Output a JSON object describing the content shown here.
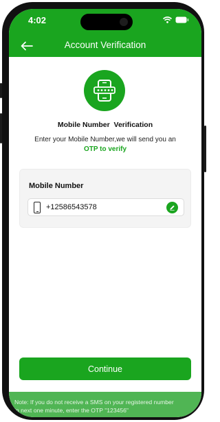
{
  "status_bar": {
    "time": "4:02"
  },
  "app_bar": {
    "title": "Account Verification"
  },
  "verification": {
    "title": "Mobile Number  Verification",
    "description": "Enter your Mobile Number,we will send you an",
    "highlight": "OTP to verify"
  },
  "form": {
    "label": "Mobile Number",
    "phone_value": "+12586543578"
  },
  "actions": {
    "continue_label": "Continue"
  },
  "note": {
    "line1": "Note:  If you do not receive a SMS on your registered number",
    "line2": "in next one minute, enter the OTP \"123456\""
  },
  "colors": {
    "primary": "#1aa51f",
    "note_bg": "#50b554"
  },
  "icons": {
    "back": "arrow-left-icon",
    "verify": "phone-password-icon",
    "phone": "smartphone-icon",
    "edit": "pencil-icon",
    "wifi": "wifi-icon",
    "battery": "battery-icon"
  }
}
